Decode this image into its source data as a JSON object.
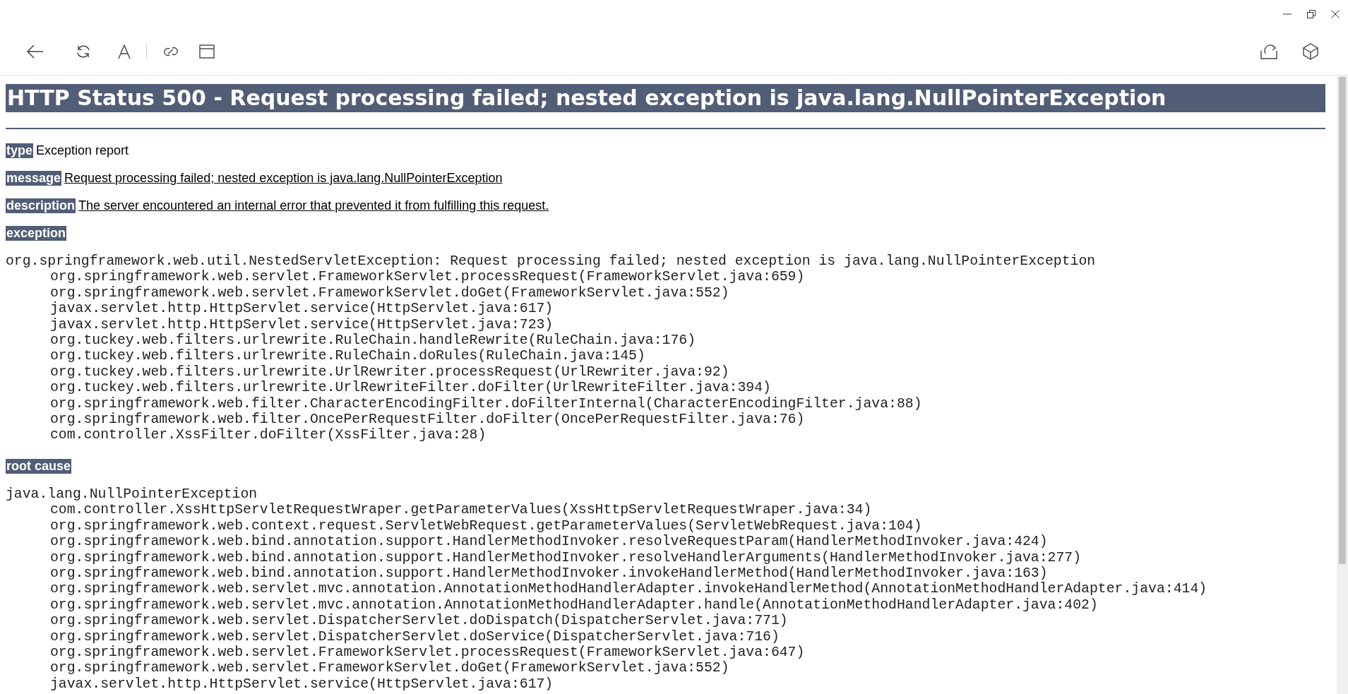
{
  "heading": "HTTP Status 500 - Request processing failed; nested exception is java.lang.NullPointerException",
  "fields": [
    {
      "label": "type",
      "value": "Exception report",
      "underlined": false
    },
    {
      "label": "message",
      "value": "Request processing failed; nested exception is java.lang.NullPointerException",
      "underlined": true
    },
    {
      "label": "description",
      "value": "The server encountered an internal error that prevented it from fulfilling this request.",
      "underlined": true
    }
  ],
  "traces": [
    {
      "label": "exception",
      "first_line": "org.springframework.web.util.NestedServletException: Request processing failed; nested exception is java.lang.NullPointerException",
      "frames": [
        "org.springframework.web.servlet.FrameworkServlet.processRequest(FrameworkServlet.java:659)",
        "org.springframework.web.servlet.FrameworkServlet.doGet(FrameworkServlet.java:552)",
        "javax.servlet.http.HttpServlet.service(HttpServlet.java:617)",
        "javax.servlet.http.HttpServlet.service(HttpServlet.java:723)",
        "org.tuckey.web.filters.urlrewrite.RuleChain.handleRewrite(RuleChain.java:176)",
        "org.tuckey.web.filters.urlrewrite.RuleChain.doRules(RuleChain.java:145)",
        "org.tuckey.web.filters.urlrewrite.UrlRewriter.processRequest(UrlRewriter.java:92)",
        "org.tuckey.web.filters.urlrewrite.UrlRewriteFilter.doFilter(UrlRewriteFilter.java:394)",
        "org.springframework.web.filter.CharacterEncodingFilter.doFilterInternal(CharacterEncodingFilter.java:88)",
        "org.springframework.web.filter.OncePerRequestFilter.doFilter(OncePerRequestFilter.java:76)",
        "com.controller.XssFilter.doFilter(XssFilter.java:28)"
      ]
    },
    {
      "label": "root cause",
      "first_line": "java.lang.NullPointerException",
      "frames": [
        "com.controller.XssHttpServletRequestWraper.getParameterValues(XssHttpServletRequestWraper.java:34)",
        "org.springframework.web.context.request.ServletWebRequest.getParameterValues(ServletWebRequest.java:104)",
        "org.springframework.web.bind.annotation.support.HandlerMethodInvoker.resolveRequestParam(HandlerMethodInvoker.java:424)",
        "org.springframework.web.bind.annotation.support.HandlerMethodInvoker.resolveHandlerArguments(HandlerMethodInvoker.java:277)",
        "org.springframework.web.bind.annotation.support.HandlerMethodInvoker.invokeHandlerMethod(HandlerMethodInvoker.java:163)",
        "org.springframework.web.servlet.mvc.annotation.AnnotationMethodHandlerAdapter.invokeHandlerMethod(AnnotationMethodHandlerAdapter.java:414)",
        "org.springframework.web.servlet.mvc.annotation.AnnotationMethodHandlerAdapter.handle(AnnotationMethodHandlerAdapter.java:402)",
        "org.springframework.web.servlet.DispatcherServlet.doDispatch(DispatcherServlet.java:771)",
        "org.springframework.web.servlet.DispatcherServlet.doService(DispatcherServlet.java:716)",
        "org.springframework.web.servlet.FrameworkServlet.processRequest(FrameworkServlet.java:647)",
        "org.springframework.web.servlet.FrameworkServlet.doGet(FrameworkServlet.java:552)",
        "javax.servlet.http.HttpServlet.service(HttpServlet.java:617)"
      ]
    }
  ]
}
